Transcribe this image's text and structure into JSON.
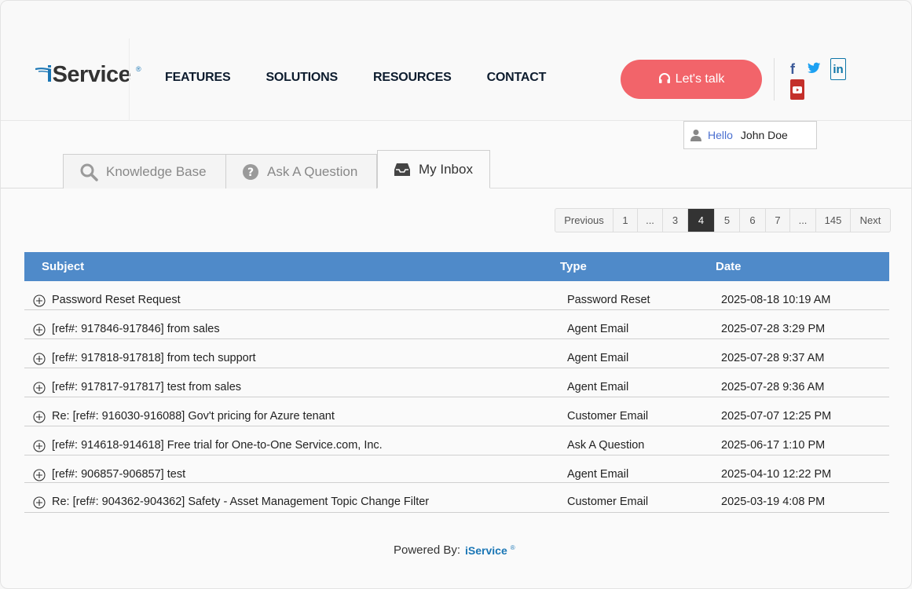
{
  "header": {
    "logo_text": "iService",
    "nav": [
      "FEATURES",
      "SOLUTIONS",
      "RESOURCES",
      "CONTACT"
    ],
    "cta_label": "Let's talk",
    "social": [
      "facebook-icon",
      "twitter-icon",
      "linkedin-icon",
      "youtube-icon"
    ]
  },
  "user": {
    "greeting": "Hello",
    "name": "John Doe"
  },
  "tabs": [
    {
      "label": "Knowledge Base",
      "icon": "search-icon"
    },
    {
      "label": "Ask A Question",
      "icon": "question-icon"
    },
    {
      "label": "My Inbox",
      "icon": "inbox-icon",
      "active": true
    }
  ],
  "pagination": {
    "previous": "Previous",
    "pages": [
      "1",
      "...",
      "3",
      "4",
      "5",
      "6",
      "7",
      "...",
      "145"
    ],
    "current": "4",
    "next": "Next"
  },
  "table": {
    "headers": [
      "Subject",
      "Type",
      "Date"
    ],
    "rows": [
      {
        "subject": "Password Reset Request",
        "type": "Password Reset",
        "date": "2025-08-18 10:19 AM"
      },
      {
        "subject": "[ref#: 917846-917846] from sales",
        "type": "Agent Email",
        "date": "2025-07-28 3:29 PM"
      },
      {
        "subject": "[ref#: 917818-917818] from tech support",
        "type": "Agent Email",
        "date": "2025-07-28 9:37 AM"
      },
      {
        "subject": "[ref#: 917817-917817] test from sales",
        "type": "Agent Email",
        "date": "2025-07-28 9:36 AM"
      },
      {
        "subject": "Re: [ref#: 916030-916088] Gov't pricing for Azure tenant",
        "type": "Customer Email",
        "date": "2025-07-07 12:25 PM"
      },
      {
        "subject": "[ref#: 914618-914618] Free trial for One-to-One Service.com, Inc.",
        "type": "Ask A Question",
        "date": "2025-06-17 1:10 PM"
      },
      {
        "subject": "[ref#: 906857-906857] test",
        "type": "Agent Email",
        "date": "2025-04-10 12:22 PM"
      },
      {
        "subject": "Re: [ref#: 904362-904362] Safety - Asset Management Topic Change Filter",
        "type": "Customer Email",
        "date": "2025-03-19 4:08 PM"
      }
    ]
  },
  "footer": {
    "powered_by": "Powered By:",
    "brand": "iService",
    "reg": "®"
  },
  "colors": {
    "accent": "#4f8ac9",
    "cta": "#f2646a",
    "brand": "#1a76b5"
  }
}
